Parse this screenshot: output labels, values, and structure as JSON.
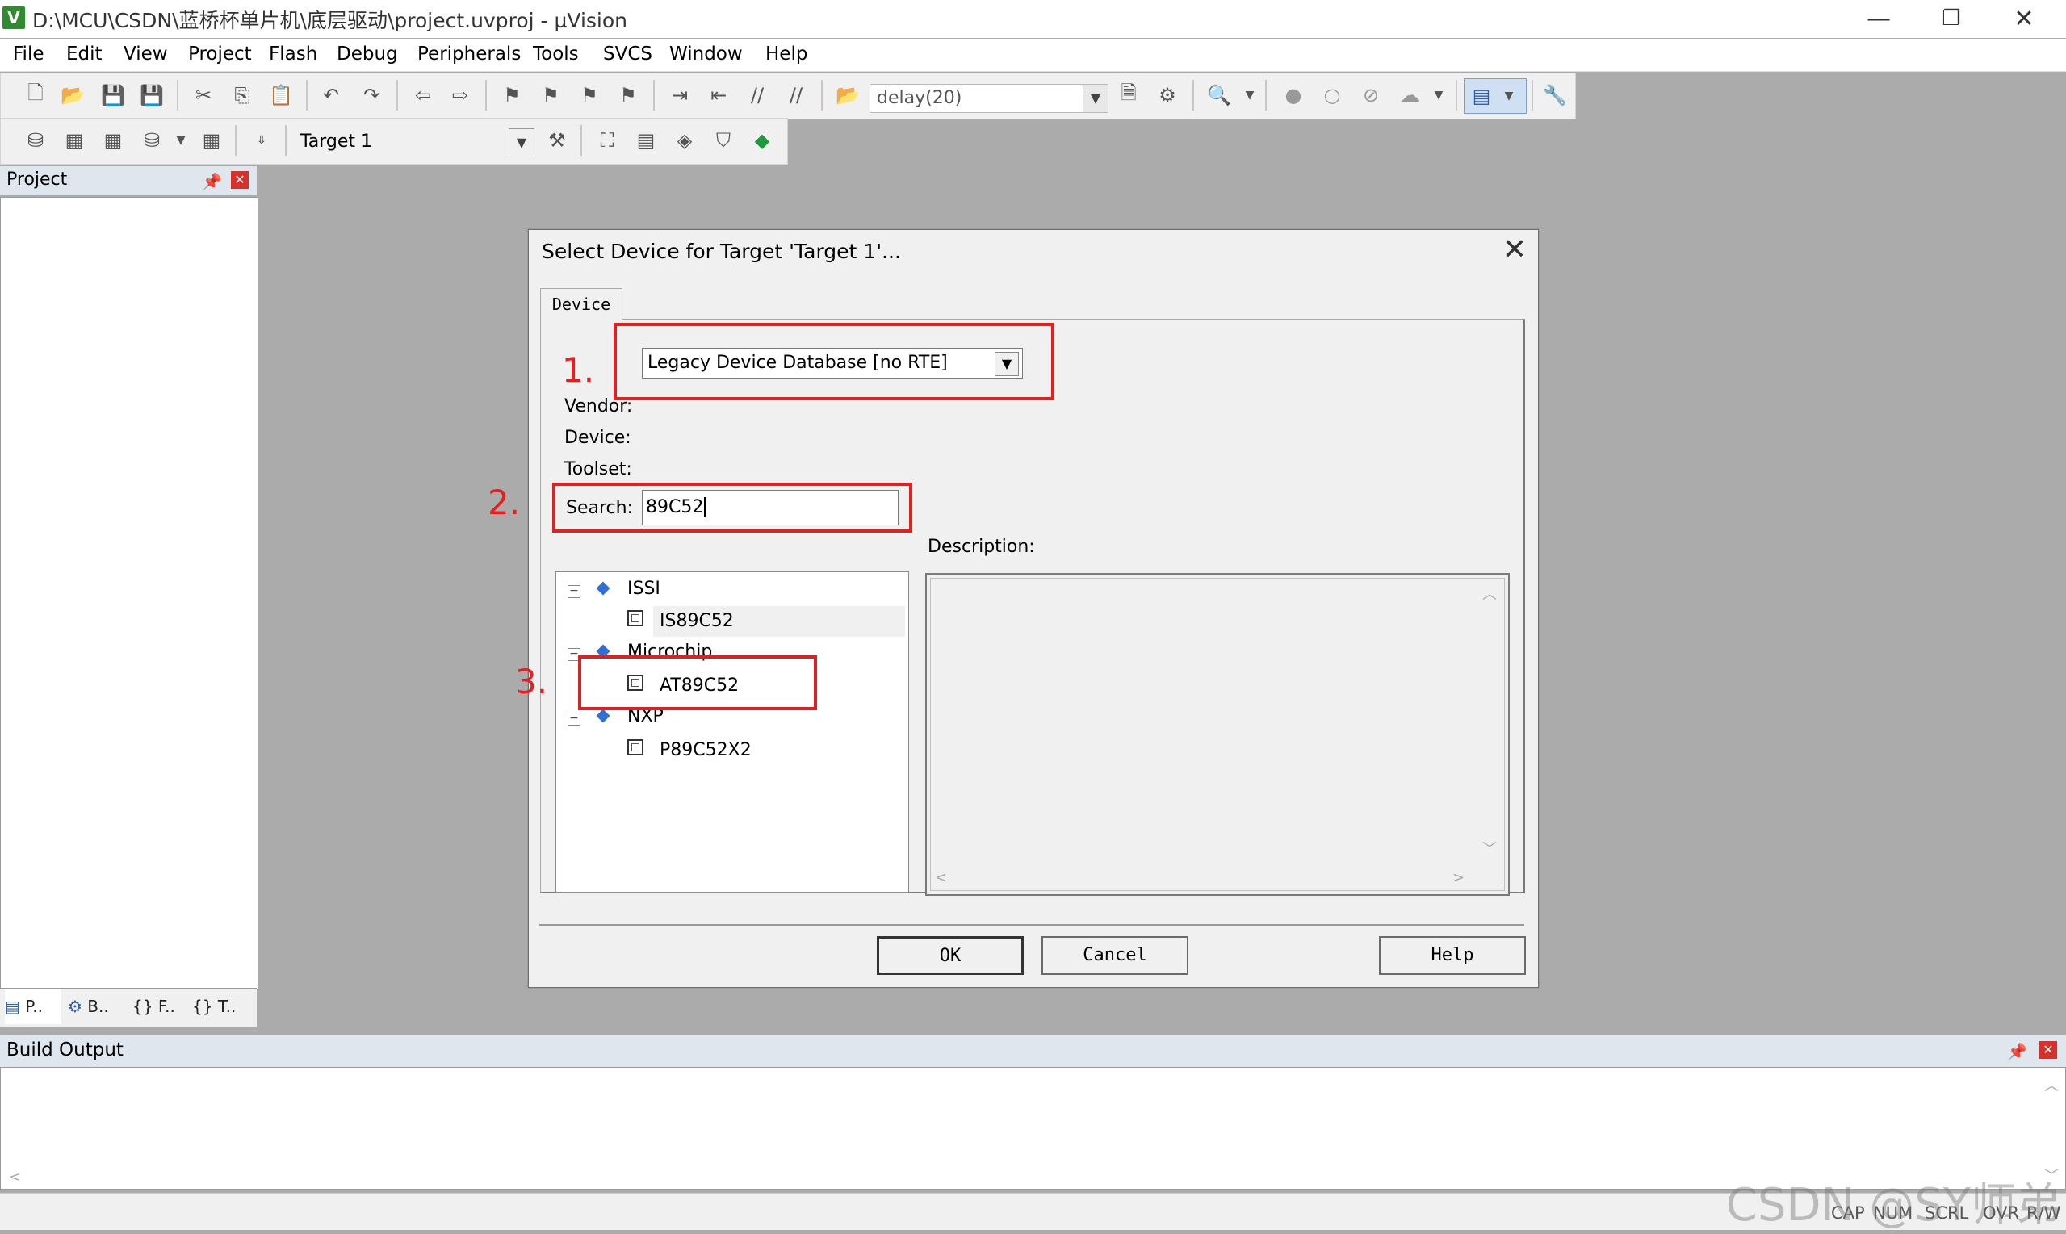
{
  "window": {
    "title": "D:\\MCU\\CSDN\\蓝桥杯单片机\\底层驱动\\project.uvproj - µVision",
    "app_icon": "V"
  },
  "menu": [
    "File",
    "Edit",
    "View",
    "Project",
    "Flash",
    "Debug",
    "Peripherals",
    "Tools",
    "SVCS",
    "Window",
    "Help"
  ],
  "toolbar": {
    "find_combo": "delay(20)",
    "target_combo": "Target 1"
  },
  "project_pane": {
    "title": "Project",
    "tabs": [
      "P..",
      "B..",
      "F..",
      "T.."
    ]
  },
  "dialog": {
    "title": "Select Device for Target 'Target 1'...",
    "tab_label": "Device",
    "database_select": "Legacy Device Database [no RTE]",
    "vendor_label": "Vendor:",
    "device_label": "Device:",
    "toolset_label": "Toolset:",
    "search_label": "Search:",
    "search_value": "89C52",
    "description_label": "Description:",
    "tree": [
      {
        "vendor": "ISSI",
        "device": "IS89C52"
      },
      {
        "vendor": "Microchip",
        "device": "AT89C52"
      },
      {
        "vendor": "NXP",
        "device": "P89C52X2"
      }
    ],
    "buttons": {
      "ok": "OK",
      "cancel": "Cancel",
      "help": "Help"
    }
  },
  "annotations": [
    "1.",
    "2.",
    "3."
  ],
  "annotation_color": "#e32020",
  "build_output": {
    "title": "Build Output"
  },
  "status": [
    "CAP",
    "NUM",
    "SCRL",
    "OVR",
    "R/W"
  ],
  "watermark": "CSDN @SY师弟"
}
